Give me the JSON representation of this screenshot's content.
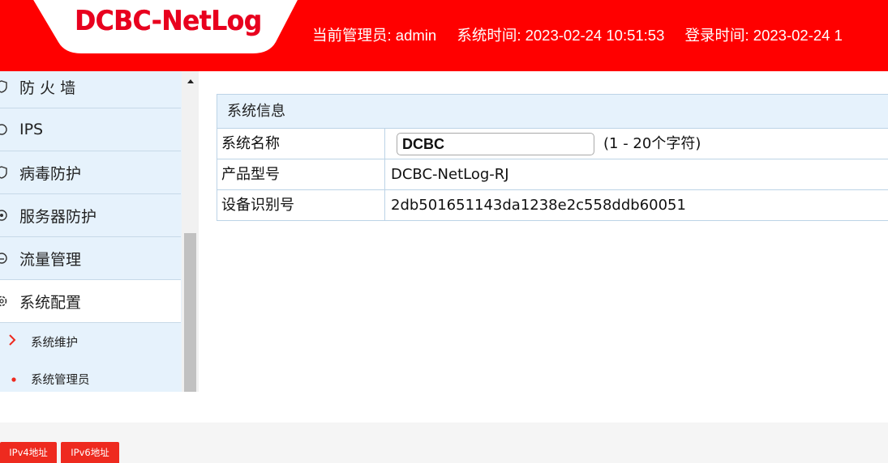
{
  "header": {
    "logo": "DCBC-NetLog",
    "admin": "当前管理员: admin",
    "system_time": "系统时间: 2023-02-24 10:51:53",
    "login_time": "登录时间: 2023-02-24 1"
  },
  "sidebar": {
    "items": [
      {
        "label": "防 火 墙",
        "icon": "shield-icon"
      },
      {
        "label": "IPS",
        "icon": "circle-icon"
      },
      {
        "label": "病毒防护",
        "icon": "shield-icon"
      },
      {
        "label": "服务器防护",
        "icon": "target-icon"
      },
      {
        "label": "流量管理",
        "icon": "gauge-icon"
      },
      {
        "label": "系统配置",
        "icon": "gear-icon",
        "active": true
      }
    ],
    "sub_items": [
      {
        "label": "系统维护",
        "icon": "chevron-right-icon"
      },
      {
        "label": "系统管理员",
        "icon": "dot-icon"
      }
    ]
  },
  "panel": {
    "title": "系统信息",
    "rows": [
      {
        "key": "系统名称",
        "input_value": "DCBC",
        "hint": "(1 - 20个字符)"
      },
      {
        "key": "产品型号",
        "value": "DCBC-NetLog-RJ"
      },
      {
        "key": "设备识别号",
        "value": "2db501651143da1238e2c558ddb60051"
      }
    ]
  },
  "tabs": [
    "IPv4地址",
    "IPv6地址"
  ],
  "colors": {
    "brand_red": "#ff0000",
    "logo_red": "#e8001e",
    "sidebar_bg": "#e6f2fc",
    "tab_red": "#ee2a1f"
  }
}
